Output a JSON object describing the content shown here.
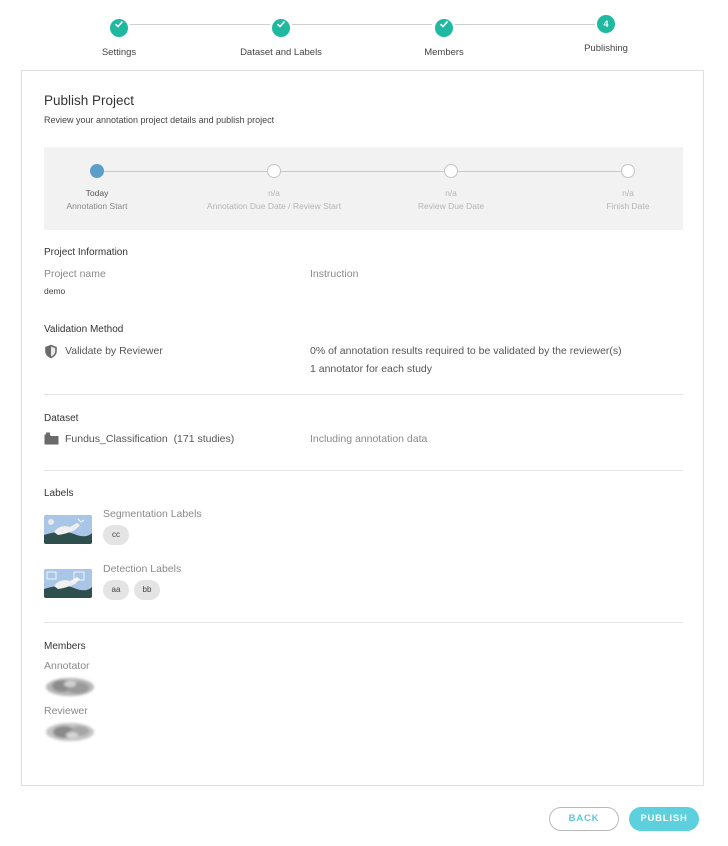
{
  "steps": [
    {
      "label": "Settings",
      "state": "done",
      "number": ""
    },
    {
      "label": "Dataset and Labels",
      "state": "done",
      "number": ""
    },
    {
      "label": "Members",
      "state": "done",
      "number": ""
    },
    {
      "label": "Publishing",
      "state": "current",
      "number": "4"
    }
  ],
  "header": {
    "title": "Publish Project",
    "subtitle": "Review your annotation project details and publish project"
  },
  "timeline": [
    {
      "date": "Today",
      "name": "Annotation Start",
      "active": true
    },
    {
      "date": "n/a",
      "name": "Annotation Due Date / Review Start",
      "active": false
    },
    {
      "date": "n/a",
      "name": "Review Due Date",
      "active": false
    },
    {
      "date": "n/a",
      "name": "Finish Date",
      "active": false
    }
  ],
  "project_info": {
    "title": "Project Information",
    "name_label": "Project name",
    "name_value": "demo",
    "instruction_label": "Instruction"
  },
  "validation": {
    "title": "Validation Method",
    "method": "Validate by Reviewer",
    "line1": "0% of annotation results required to be validated by the reviewer(s)",
    "line2": "1 annotator for each study"
  },
  "dataset": {
    "title": "Dataset",
    "name": "Fundus_Classification",
    "count": "(171 studies)",
    "note": "Including annotation data"
  },
  "labels": {
    "title": "Labels",
    "segmentation": {
      "label": "Segmentation Labels",
      "chips": [
        "cc"
      ]
    },
    "detection": {
      "label": "Detection Labels",
      "chips": [
        "aa",
        "bb"
      ]
    }
  },
  "members": {
    "title": "Members",
    "annotator_label": "Annotator",
    "reviewer_label": "Reviewer"
  },
  "buttons": {
    "back": "BACK",
    "publish": "PUBLISH"
  },
  "colors": {
    "step_done": "#1fb8a0",
    "timeline_active": "#5b9ec9",
    "publish_button": "#5dd0de"
  },
  "icons": {
    "step_done": "check-icon",
    "validation": "shield-icon",
    "dataset": "folder-icon"
  }
}
